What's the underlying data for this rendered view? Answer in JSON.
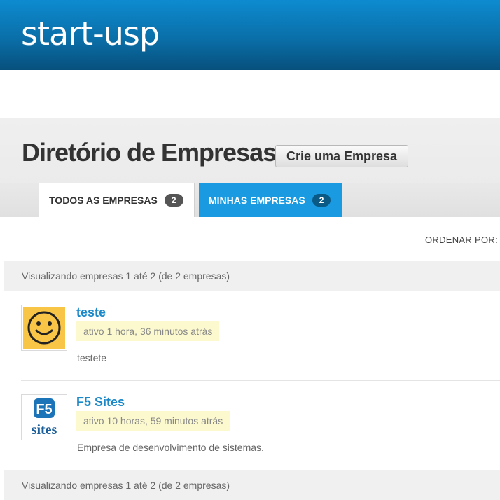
{
  "site": {
    "logo": "start-usp"
  },
  "directory": {
    "title": "Diretório de Empresas",
    "create_button": "Crie uma Empresa",
    "tabs": [
      {
        "label": "TODOS AS EMPRESAS",
        "count": "2",
        "active": true
      },
      {
        "label": "MINHAS EMPRESAS",
        "count": "2",
        "active": false
      }
    ],
    "order_label": "ORDENAR POR:",
    "pagination_text": "Visualizando empresas 1 até 2 (de 2 empresas)"
  },
  "companies": [
    {
      "name": "teste",
      "active": "ativo 1 hora, 36 minutos atrás",
      "description": "testete",
      "avatar_icon": "smiley-face-icon"
    },
    {
      "name": "F5 Sites",
      "active": "ativo 10 horas, 59 minutos atrás",
      "description": "Empresa de desenvolvimento de sistemas.",
      "avatar_icon": "f5-sites-logo",
      "logo_text_top": "F5",
      "logo_text_bottom": "sites"
    }
  ],
  "colors": {
    "header_blue": "#0a6fa8",
    "tab_active_blue": "#1a9ae0",
    "link_blue": "#1a88c9",
    "highlight_yellow": "#fcf9cf",
    "smiley_yellow": "#f9c546"
  }
}
